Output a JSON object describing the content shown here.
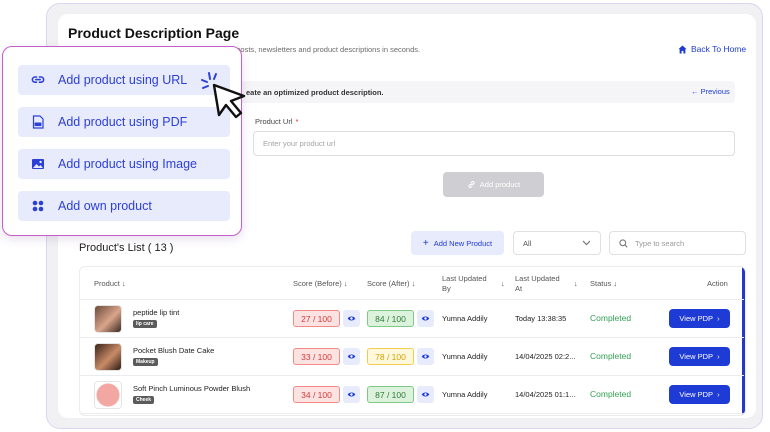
{
  "page": {
    "title": "Product Description Page",
    "subtitle": "a posts, newsletters and product descriptions in seconds.",
    "back_home": "Back To Home"
  },
  "step": {
    "text": "eate an optimized product description.",
    "previous": "Previous"
  },
  "form": {
    "url_label": "Product Url",
    "required_mark": "*",
    "url_placeholder": "Enter your product url",
    "add_button": "Add product"
  },
  "menu": {
    "items": [
      {
        "label": "Add product using URL",
        "icon": "link-icon"
      },
      {
        "label": "Add product using PDF",
        "icon": "pdf-icon"
      },
      {
        "label": "Add product using Image",
        "icon": "image-icon"
      },
      {
        "label": "Add own product",
        "icon": "grid-icon"
      }
    ]
  },
  "list": {
    "title": "Product's List ( 13 )",
    "add_new": "Add New Product",
    "filter_value": "All",
    "search_placeholder": "Type to search"
  },
  "table": {
    "headers": {
      "product": "Product",
      "score_before": "Score (Before)",
      "score_after": "Score (After)",
      "updated_by_1": "Last Updated",
      "updated_by_2": "By",
      "updated_at_1": "Last Updated",
      "updated_at_2": "At",
      "status": "Status",
      "action": "Action"
    },
    "rows": [
      {
        "name": "peptide lip tint",
        "tag": "lip care",
        "before": "27 / 100",
        "after": "84 / 100",
        "after_color": "green",
        "by": "Yumna Addily",
        "at": "Today 13:38:35",
        "status": "Completed",
        "action": "View PDP"
      },
      {
        "name": "Pocket Blush Date Cake",
        "tag": "Makeup",
        "before": "33 / 100",
        "after": "78 / 100",
        "after_color": "yellow",
        "by": "Yumna Addily",
        "at": "14/04/2025 02:2...",
        "status": "Completed",
        "action": "View PDP"
      },
      {
        "name": "Soft Pinch Luminous Powder Blush",
        "tag": "Cheek",
        "before": "34 / 100",
        "after": "87 / 100",
        "after_color": "green",
        "by": "Yumna Addily",
        "at": "14/04/2025 01:1...",
        "status": "Completed",
        "action": "View PDP"
      }
    ]
  },
  "colors": {
    "accent": "#1f3bd6",
    "menu_border": "#c65ec9",
    "status_green": "#33a155"
  }
}
